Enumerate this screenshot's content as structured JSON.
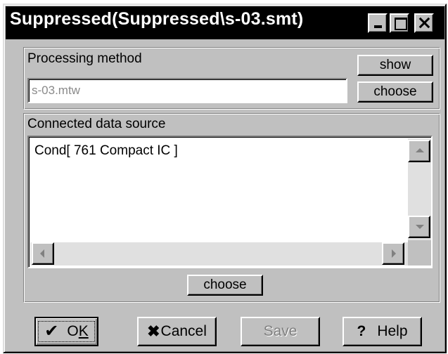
{
  "window": {
    "title": "Suppressed(Suppressed\\s-03.smt)"
  },
  "method": {
    "label": "Processing method",
    "value": "s-03.mtw",
    "show_label": "show",
    "choose_label": "choose"
  },
  "source": {
    "label": "Connected  data source",
    "items": [
      "Cond[ 761 Compact IC ]"
    ],
    "choose_label": "choose"
  },
  "footer": {
    "ok_main": "O",
    "ok_underlined": "K",
    "cancel_label": "Cancel",
    "save_label": "Save",
    "help_label": "Help",
    "help_symbol": "?"
  },
  "icons": {
    "ok": "check-icon",
    "cancel": "x-icon",
    "help": "question-icon"
  },
  "colors": {
    "titlebar": "#000000",
    "face": "#c0c0c0",
    "disabled_text": "#808080"
  }
}
